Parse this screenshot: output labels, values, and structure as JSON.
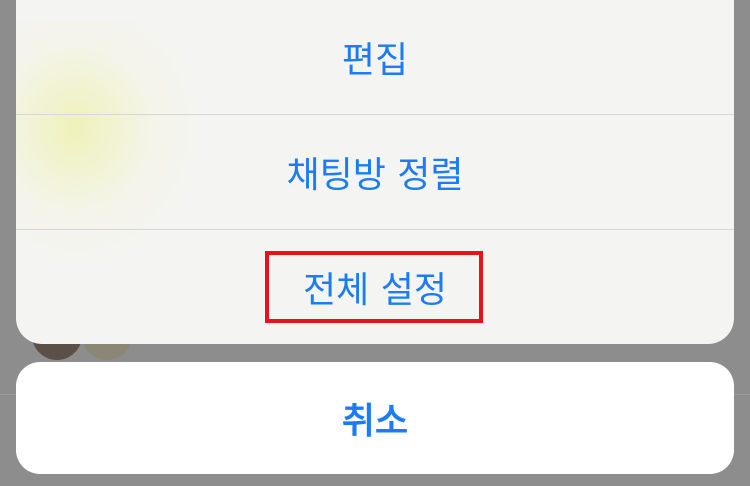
{
  "action_sheet": {
    "items": [
      {
        "label": "편집"
      },
      {
        "label": "채팅방 정렬"
      },
      {
        "label": "전체 설정"
      }
    ],
    "cancel_label": "취소"
  },
  "colors": {
    "action_text": "#1b7cf5",
    "highlight_border": "#e8121b",
    "dim_background": "#8d8d8d"
  }
}
